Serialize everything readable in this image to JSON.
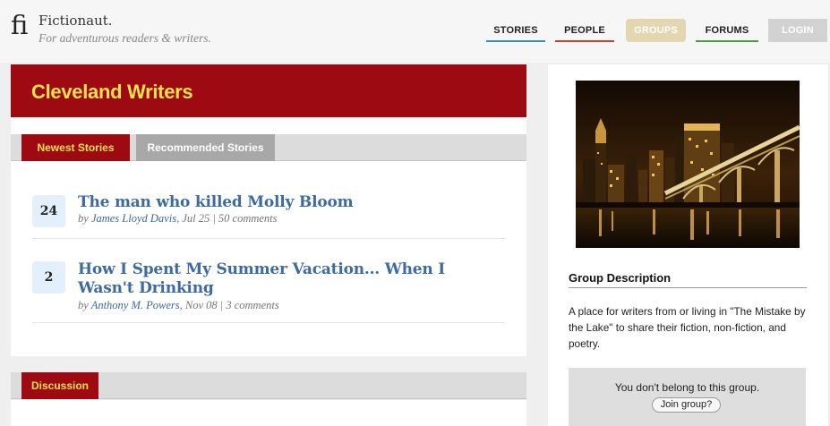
{
  "header": {
    "logo_mark": "fi",
    "brand": "Fictionaut.",
    "tagline": "For adventurous readers & writers."
  },
  "nav": {
    "stories": "STORIES",
    "people": "PEOPLE",
    "groups": "GROUPS",
    "forums": "FORUMS",
    "login": "LOGIN"
  },
  "colors": {
    "accent_red": "#9e0a12",
    "accent_yellow": "#f9e24c",
    "link_blue": "#3c6aa3",
    "stories_underline": "#3a8cc4",
    "people_underline": "#c9402c",
    "forums_underline": "#4a9d3a"
  },
  "group": {
    "title": "Cleveland Writers"
  },
  "tabs": {
    "newest": "Newest Stories",
    "recommended": "Recommended Stories"
  },
  "stories": [
    {
      "count": "24",
      "title": "The man who killed Molly Bloom",
      "by": "by ",
      "author": "James Lloyd Davis",
      "date": ", Jul 25",
      "sep": " | ",
      "comments": "50 comments"
    },
    {
      "count": "2",
      "title": "How I Spent My Summer Vacation... When I Wasn't Drinking",
      "by": "by ",
      "author": "Anthony M. Powers",
      "date": ", Nov 08",
      "sep": " | ",
      "comments": "3 comments"
    }
  ],
  "discussion": {
    "tab": "Discussion"
  },
  "sidebar": {
    "image_icon": "city-skyline-photo",
    "description_heading": "Group Description",
    "description": "A place for writers from or living in \"The Mistake by the Lake\" to share their fiction, non-fiction, and poetry.",
    "membership_text": "You don't belong to this group.",
    "join_button": "Join group?"
  }
}
